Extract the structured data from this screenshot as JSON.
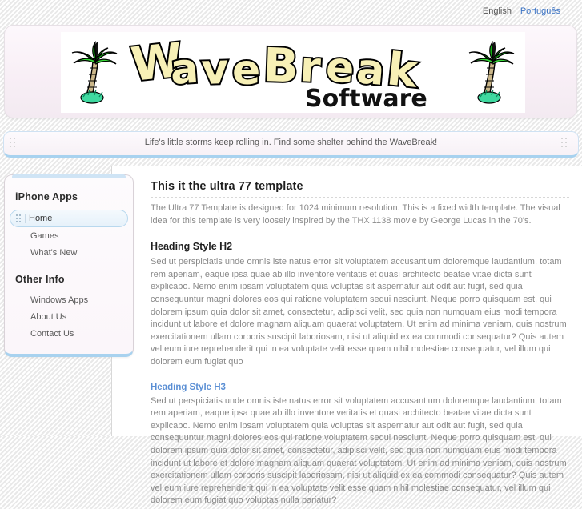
{
  "topbar": {
    "english_label": "English",
    "separator": "|",
    "portugues_label": "Português"
  },
  "header": {
    "logo_word": "WaveBreak",
    "logo_sub": "Software",
    "left_palm_icon": "palm-tree-icon",
    "right_palm_icon": "palm-tree-icon"
  },
  "tagline": {
    "text": "Life's little storms keep rolling in.  Find some shelter behind the WaveBreak!"
  },
  "sidebar": {
    "sections": [
      {
        "heading": "iPhone Apps",
        "items": [
          {
            "label": "Home",
            "active": true
          },
          {
            "label": "Games",
            "active": false
          },
          {
            "label": "What's New",
            "active": false
          }
        ]
      },
      {
        "heading": "Other Info",
        "items": [
          {
            "label": "Windows Apps",
            "active": false
          },
          {
            "label": "About Us",
            "active": false
          },
          {
            "label": "Contact Us",
            "active": false
          }
        ]
      }
    ]
  },
  "main": {
    "title": "This it the ultra 77 template",
    "intro": "The Ultra 77 Template is designed for 1024 minimum resolution. This is a fixed width template. The visual idea for this template is very loosely inspired by the THX 1138 movie by George Lucas in the 70's.",
    "h2_heading": "Heading Style H2",
    "h2_body": "Sed ut perspiciatis unde omnis iste natus error sit voluptatem accusantium doloremque laudantium, totam rem aperiam, eaque ipsa quae ab illo inventore veritatis et quasi architecto beatae vitae dicta sunt explicabo. Nemo enim ipsam voluptatem quia voluptas sit aspernatur aut odit aut fugit, sed quia consequuntur magni dolores eos qui ratione voluptatem sequi nesciunt. Neque porro quisquam est, qui dolorem ipsum quia dolor sit amet, consectetur, adipisci velit, sed quia non numquam eius modi tempora incidunt ut labore et dolore magnam aliquam quaerat voluptatem. Ut enim ad minima veniam, quis nostrum exercitationem ullam corporis suscipit laboriosam, nisi ut aliquid ex ea commodi consequatur? Quis autem vel eum iure reprehenderit qui in ea voluptate velit esse quam nihil molestiae consequatur, vel illum qui dolorem eum fugiat quo",
    "help_badge_label": "?",
    "h3_heading": "Heading Style H3",
    "h3_body": "Sed ut perspiciatis unde omnis iste natus error sit voluptatem accusantium doloremque laudantium, totam rem aperiam, eaque ipsa quae ab illo inventore veritatis et quasi architecto beatae vitae dicta sunt explicabo. Nemo enim ipsam voluptatem quia voluptas sit aspernatur aut odit aut fugit, sed quia consequuntur magni dolores eos qui ratione voluptatem sequi nesciunt. Neque porro quisquam est, qui dolorem ipsum quia dolor sit amet, consectetur, adipisci velit, sed quia non numquam eius modi tempora incidunt ut labore et dolore magnam aliquam quaerat voluptatem. Ut enim ad minima veniam, quis nostrum exercitationem ullam corporis suscipit laboriosam, nisi ut aliquid ex ea commodi consequatur? Quis autem vel eum iure reprehenderit qui in ea voluptate velit esse quam nihil molestiae consequatur, vel illum qui dolorem eum fugiat quo voluptas nulla pariatur?"
  },
  "colors": {
    "accent_blue": "#a8d2ef",
    "link_blue": "#3b73c4",
    "h3_blue": "#5b8fd4",
    "header_pink": "#f8eff6",
    "logo_cream": "#f7f0b6"
  }
}
